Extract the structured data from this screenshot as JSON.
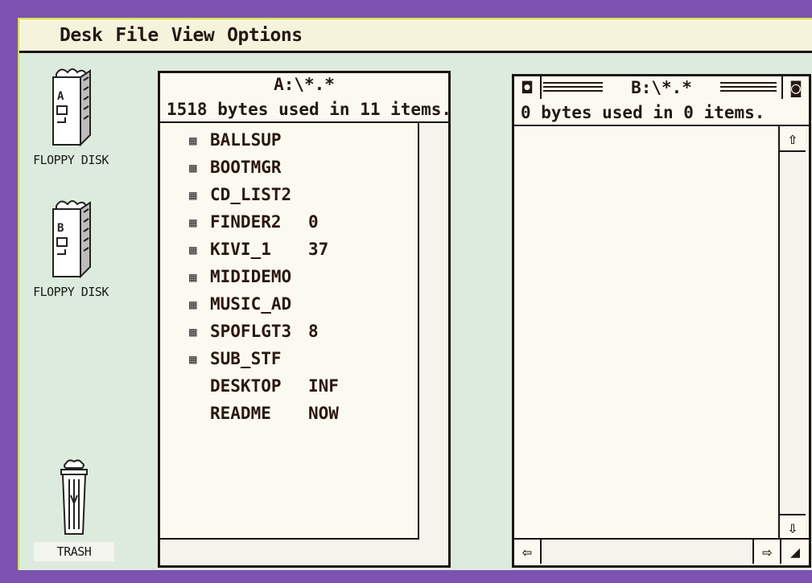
{
  "menubar": {
    "items": [
      "Desk",
      "File",
      "View",
      "Options"
    ]
  },
  "desktop": {
    "drive_a_label": "FLOPPY DISK",
    "drive_a_letter": "A",
    "drive_b_label": "FLOPPY DISK",
    "drive_b_letter": "B",
    "trash_label": "TRASH"
  },
  "window_a": {
    "title": "A:\\*.*",
    "info": "1518 bytes used in 11 items.",
    "files": [
      {
        "icon": "folder",
        "name": "BALLSUP",
        "ext": ""
      },
      {
        "icon": "folder",
        "name": "BOOTMGR",
        "ext": ""
      },
      {
        "icon": "folder",
        "name": "CD_LIST2",
        "ext": ""
      },
      {
        "icon": "folder",
        "name": "FINDER2",
        "ext": "0"
      },
      {
        "icon": "folder",
        "name": "KIVI_1",
        "ext": "37"
      },
      {
        "icon": "folder",
        "name": "MIDIDEMO",
        "ext": ""
      },
      {
        "icon": "folder",
        "name": "MUSIC_AD",
        "ext": ""
      },
      {
        "icon": "folder",
        "name": "SPOFLGT3",
        "ext": "8"
      },
      {
        "icon": "folder",
        "name": "SUB_STF",
        "ext": ""
      },
      {
        "icon": "file",
        "name": "DESKTOP",
        "ext": "INF"
      },
      {
        "icon": "file",
        "name": "README",
        "ext": "NOW"
      }
    ]
  },
  "window_b": {
    "title": "B:\\*.*",
    "info": "0 bytes used in 0 items.",
    "close_glyph": "◘",
    "full_glyph": "◙",
    "up_glyph": "⇧",
    "down_glyph": "⇩",
    "left_glyph": "⇦",
    "right_glyph": "⇨",
    "size_glyph": "◢"
  },
  "colors": {
    "frame": "#7e52b0",
    "desktop": "#dcebdd",
    "window": "#fbf9f0",
    "ink": "#241812"
  }
}
